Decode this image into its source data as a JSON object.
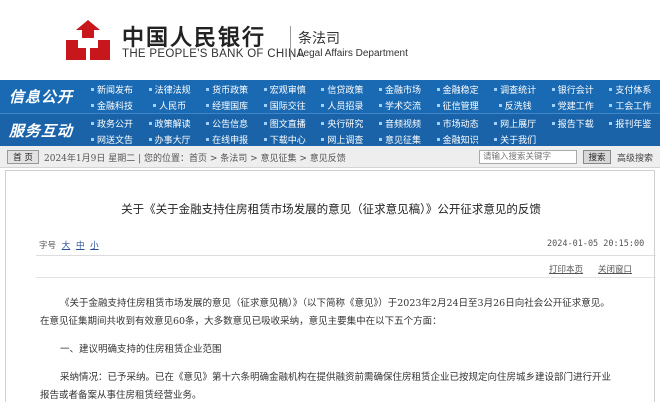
{
  "header": {
    "bank_name_cn": "中国人民银行",
    "bank_name_en": "THE PEOPLE'S BANK OF CHINA",
    "dept_cn": "条法司",
    "dept_en": "Legal Affairs Department",
    "logo_icon": "pboc-logo-icon",
    "logo_color": "#c8161d"
  },
  "nav": {
    "row1_label": "信息公开",
    "row2_label": "服务互动",
    "row1_items": [
      "新闻发布",
      "法律法规",
      "货币政策",
      "宏观审慎",
      "信贷政策",
      "金融市场",
      "金融稳定",
      "调查统计",
      "银行会计",
      "支付体系",
      "金融科技",
      "人民币",
      "经理国库",
      "国际交往",
      "人员招录",
      "学术交流",
      "征信管理",
      "反洗钱",
      "党建工作",
      "工会工作"
    ],
    "row2_items": [
      "政务公开",
      "政策解读",
      "公告信息",
      "图文直播",
      "央行研究",
      "音频视频",
      "市场动态",
      "网上展厅",
      "报告下载",
      "报刊年鉴",
      "网送文告",
      "办事大厅",
      "在线申报",
      "下载中心",
      "网上调查",
      "意见征集",
      "金融知识",
      "关于我们"
    ],
    "accent": "#1a6ab3"
  },
  "breadcrumb": {
    "home_button": "首 页",
    "text": "2024年1月9日 星期二 | 您的位置：首页 > 条法司 > 意见征集 > 意见反馈",
    "search_placeholder": "请输入搜索关键字",
    "search_button": "搜索",
    "advanced_search": "高级搜索"
  },
  "article": {
    "title": "关于《关于金融支持住房租赁市场发展的意见（征求意见稿）》公开征求意见的反馈",
    "font_size_label": "字号",
    "font_size_options": [
      "大",
      "中",
      "小"
    ],
    "date": "2024-01-05 20:15:00",
    "print_link": "打印本页",
    "close_link": "关闭窗口",
    "paragraphs": [
      "《关于金融支持住房租赁市场发展的意见（征求意见稿）》（以下简称《意见》）于2023年2月24日至3月26日向社会公开征求意见。",
      "在意见征集期间共收到有效意见60条，大多数意见已吸收采纳，意见主要集中在以下五个方面：",
      "一、建议明确支持的住房租赁企业范围",
      "采纳情况：已予采纳。已在《意见》第十六条明确金融机构在提供融资前需确保住房租赁企业已按规定向住房城乡建设部门进行开业",
      "报告或者备案从事住房租赁经营业务。"
    ]
  }
}
